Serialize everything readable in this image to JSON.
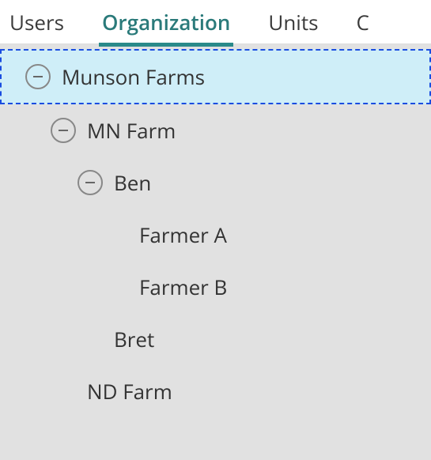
{
  "tabs": {
    "users": "Users",
    "organization": "Organization",
    "units": "Units",
    "partial": "C"
  },
  "tree": {
    "root": "Munson Farms",
    "mn_farm": "MN Farm",
    "ben": "Ben",
    "farmer_a": "Farmer A",
    "farmer_b": "Farmer B",
    "bret": "Bret",
    "nd_farm": "ND Farm"
  },
  "colors": {
    "accent": "#2a8a8a",
    "selection_bg": "#cfeef8",
    "selection_border": "#1a4de0"
  }
}
